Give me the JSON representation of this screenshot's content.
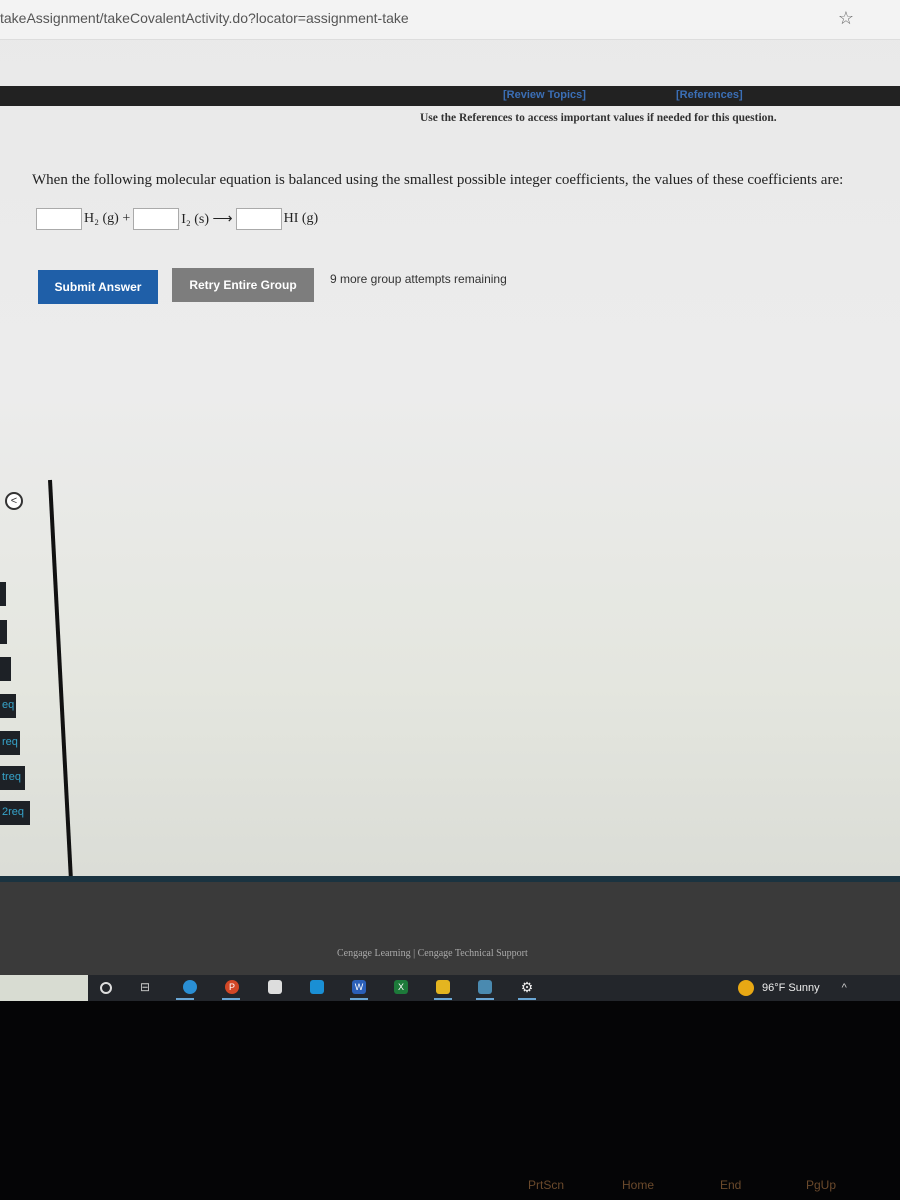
{
  "browser": {
    "url": "takeAssignment/takeCovalentActivity.do?locator=assignment-take"
  },
  "header": {
    "review_topics": "[Review Topics]",
    "references": "[References]",
    "note": "Use the References to access important values if needed for this question."
  },
  "question": {
    "text": "When the following molecular equation is balanced using the smallest possible integer coefficients, the values of these coefficients are:",
    "equation": {
      "term1": "H₂ (g) +",
      "term2": "I₂ (s) ⟶",
      "term3": "HI (g)",
      "coefficients": [
        "",
        "",
        ""
      ]
    }
  },
  "actions": {
    "submit": "Submit Answer",
    "retry": "Retry Entire Group",
    "remaining": "9 more group attempts remaining"
  },
  "sidebar": {
    "collapse": "<",
    "items": [
      "",
      "",
      "",
      "eq",
      "req",
      "treq",
      "2req"
    ]
  },
  "footer": {
    "text": "Cengage Learning  |  Cengage Technical Support"
  },
  "taskbar": {
    "apps": [
      "cortana-icon",
      "task-view-icon",
      "edge-icon",
      "powerpoint-icon",
      "store-icon",
      "mail-icon",
      "word-icon",
      "excel-icon",
      "file-explorer-icon",
      "calculator-icon",
      "settings-icon"
    ],
    "weather": "96°F Sunny"
  },
  "keyboard": {
    "keys": [
      "PrtScn",
      "Home",
      "End",
      "PgUp"
    ]
  }
}
